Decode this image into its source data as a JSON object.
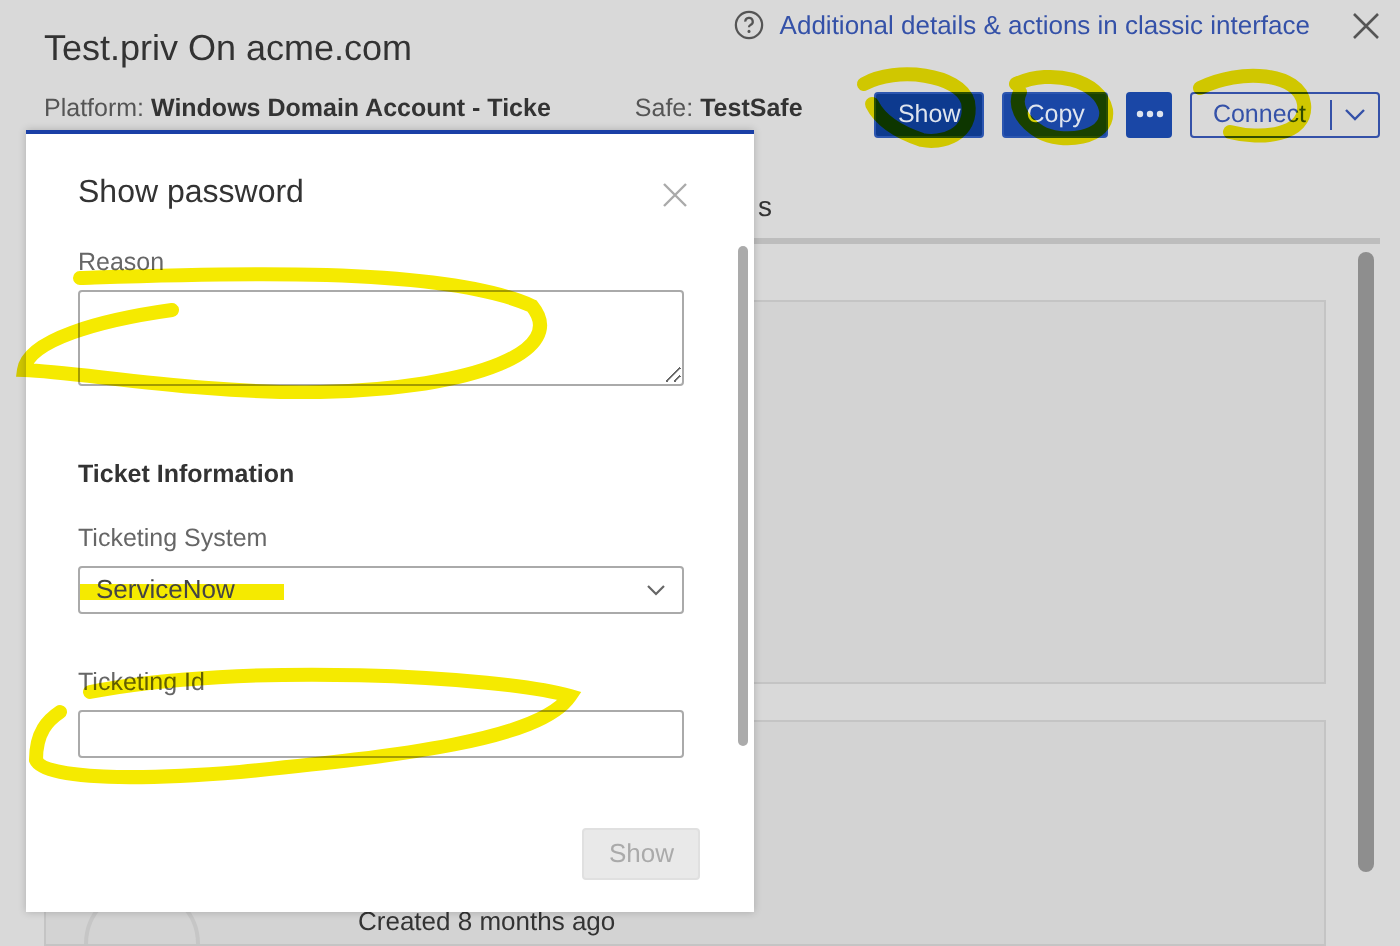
{
  "header": {
    "help_link": "Additional details & actions in classic interface",
    "title": "Test.priv On acme.com",
    "platform_label": "Platform:",
    "platform_value": "Windows Domain Account - Ticke",
    "safe_label": "Safe:",
    "safe_value": "TestSafe",
    "actions": [
      {
        "kind": "primary",
        "label": "Show"
      },
      {
        "kind": "primary",
        "label": "Copy"
      },
      {
        "kind": "more"
      },
      {
        "kind": "split",
        "label": "Connect"
      }
    ]
  },
  "tab_fragment": "s",
  "content": {
    "created_text": "Created 8 months ago"
  },
  "dialog": {
    "title": "Show password",
    "fields": [
      {
        "kind": "textarea",
        "label": "Reason"
      },
      {
        "kind": "section",
        "label": "Ticket Information"
      },
      {
        "kind": "select",
        "label": "Ticketing System",
        "value": "ServiceNow"
      },
      {
        "kind": "input",
        "label": "Ticketing Id"
      }
    ],
    "buttons": [
      {
        "label": "Show",
        "disabled": true
      }
    ]
  }
}
